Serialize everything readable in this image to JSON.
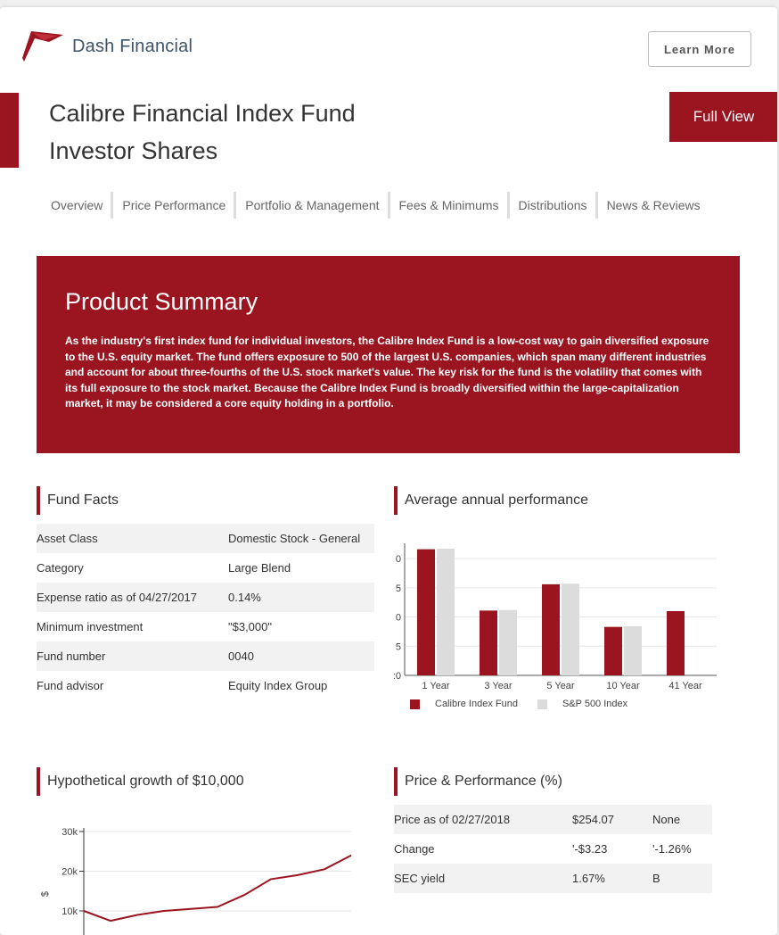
{
  "brand": {
    "name": "Dash Financial",
    "accent_color": "#9a1520"
  },
  "header": {
    "learn_more": "Learn More",
    "full_view": "Full View"
  },
  "fund": {
    "title_line1": "Calibre Financial Index Fund",
    "title_line2": "Investor Shares"
  },
  "tabs": [
    "Overview",
    "Price Performance",
    "Portfolio & Management",
    "Fees & Minimums",
    "Distributions",
    "News & Reviews"
  ],
  "summary": {
    "title": "Product Summary",
    "body": "As the industry's first index fund for individual investors, the Calibre Index Fund is a low-cost way to gain diversified exposure to the U.S. equity market. The fund offers exposure to 500 of the largest U.S. companies, which span many different industries and account for about three-fourths of the U.S. stock market's value. The key risk for the fund is the volatility that comes with its full exposure to the stock market. Because the Calibre Index Fund is broadly diversified within the large-capitalization market, it may be considered a core equity holding in a portfolio."
  },
  "fund_facts": {
    "title": "Fund Facts",
    "rows": [
      [
        "Asset Class",
        "Domestic Stock - General"
      ],
      [
        "Category",
        "Large Blend"
      ],
      [
        "Expense ratio as of 04/27/2017",
        "0.14%"
      ],
      [
        "Minimum investment",
        "\"$3,000\""
      ],
      [
        "Fund number",
        "0040"
      ],
      [
        "Fund advisor",
        "Equity Index Group"
      ]
    ]
  },
  "performance": {
    "title": "Average annual performance",
    "chart_data": {
      "type": "bar",
      "categories": [
        "1 Year",
        "3 Year",
        "5 Year",
        "10 Year",
        "41 Year"
      ],
      "y_tick_labels": [
        ":0",
        "5",
        "0",
        "5",
        "0"
      ],
      "ylim": [
        0,
        22
      ],
      "series": [
        {
          "name": "Calibre Index Fund",
          "color": "#9a1520",
          "values": [
            21.6,
            11.1,
            15.6,
            8.3,
            11.0
          ]
        },
        {
          "name": "S&P 500 Index",
          "color": "#dcdcdc",
          "values": [
            21.7,
            11.2,
            15.7,
            8.4,
            null
          ]
        }
      ],
      "grid": true,
      "legend": "bottom"
    }
  },
  "growth": {
    "title": "Hypothetical growth of $10,000",
    "chart_data": {
      "type": "line",
      "ylabel": "$",
      "y_ticks": [
        10000,
        20000,
        30000
      ],
      "y_tick_labels": [
        "10k",
        "20k",
        "30k"
      ],
      "values": [
        10000,
        7500,
        9000,
        10000,
        10500,
        11000,
        14000,
        18000,
        19000,
        20500,
        24000
      ],
      "ylim": [
        0,
        30000
      ],
      "color": "#9a1520",
      "grid": true
    }
  },
  "price_perf": {
    "title": "Price & Performance (%)",
    "rows": [
      [
        "Price as of 02/27/2018",
        "$254.07",
        "None"
      ],
      [
        "Change",
        "'-$3.23",
        "'-1.26%"
      ],
      [
        "SEC yield",
        "1.67%",
        "B"
      ]
    ]
  }
}
